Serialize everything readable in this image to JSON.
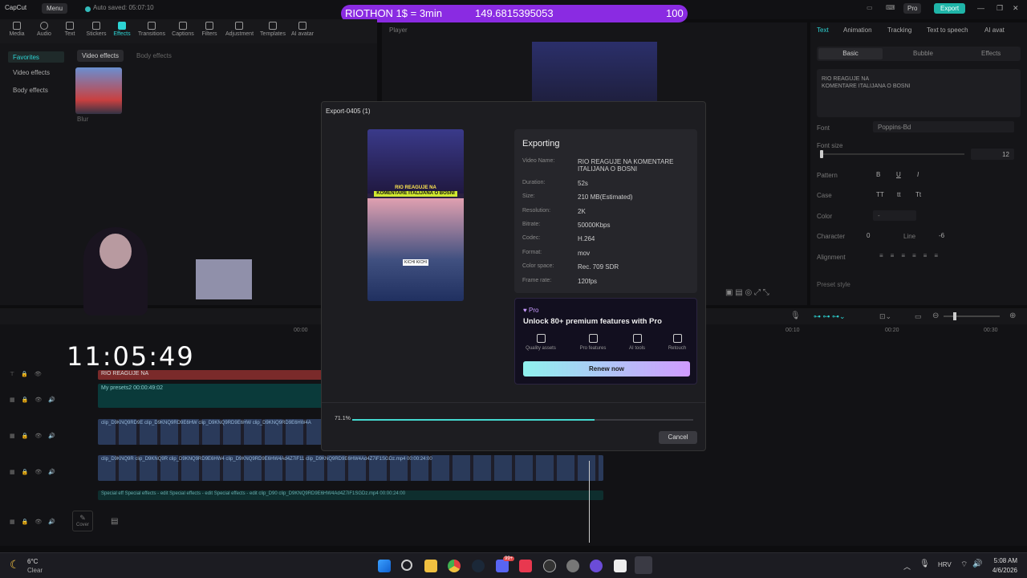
{
  "app": {
    "name": "CapCut",
    "menu_label": "Menu",
    "autosave": "Auto saved: 05:07:10",
    "pro_label": "Pro",
    "export_label": "Export"
  },
  "banner": {
    "left": "RIOTHON 1$ = 3min",
    "middle": "149.6815395053",
    "right": "100"
  },
  "toolbar": {
    "items": [
      "Media",
      "Audio",
      "Text",
      "Stickers",
      "Effects",
      "Transitions",
      "Captions",
      "Filters",
      "Adjustment",
      "Templates",
      "AI avatar"
    ],
    "active": "Effects"
  },
  "left_panel": {
    "sidebar": [
      "Favorites",
      "Video effects",
      "Body effects"
    ],
    "tabs": [
      "Video effects",
      "Body effects"
    ],
    "effect_name": "Blur"
  },
  "player": {
    "title": "Player"
  },
  "right_panel": {
    "tabs": [
      "Text",
      "Animation",
      "Tracking",
      "Text to speech",
      "AI avat"
    ],
    "subtabs": [
      "Basic",
      "Bubble",
      "Effects"
    ],
    "text_content_1": "RIO REAGUJE NA",
    "text_content_2": "KOMENTARE ITALIJANA O BOSNI",
    "font_label": "Font",
    "font_value": "Poppins-Bd",
    "font_size_label": "Font size",
    "font_size_value": "12",
    "pattern_label": "Pattern",
    "pattern_buttons": [
      "B",
      "U",
      "I"
    ],
    "case_label": "Case",
    "case_buttons": [
      "TT",
      "tt",
      "Tt"
    ],
    "color_label": "Color",
    "color_value": "-",
    "character_label": "Character",
    "character_value": "0",
    "line_label": "Line",
    "line_value": "-6",
    "alignment_label": "Alignment",
    "preset_label": "Preset style"
  },
  "timeline": {
    "times": [
      "00:00",
      "00:10",
      "00:20",
      "00:30"
    ],
    "text_track": "RIO REAGUJE NA",
    "preset_track": "My presets2  00:00:49:02",
    "clip_track_1": "clip_D9KNQ9RD9E  clip_D9KNQ9RD9E6HW  clip_D9KNQ9RD9E6HW  clip_D9KNQ9RD9E6HW4A",
    "clip_track_2": "clip_D9KNQ9R  clip_D9KNQ9R  clip_D9KNQ9RD9E6HW4  clip_D9KNQ9RD9E6HW4Ad4Z7iF11  clip_D9KNQ9RD9E6HW4Ad4Z7iF1SGDz.mp4  00:00:24:00",
    "effects_track": "Special eff  Special effects - edit  Special effects - edit  Special effects - edit  clip_D90  clip_D9KNQ9RD9E6HW4Ad4Z7iF1SGDz.mp4  00:00:24:00",
    "cover_label": "Cover"
  },
  "overlay": {
    "clock": "11:05:49"
  },
  "export_dialog": {
    "title": "Export-0405 (1)",
    "heading": "Exporting",
    "rows": [
      {
        "label": "Video Name:",
        "value": "RIO REAGUJE NA KOMENTARE ITALIJANA O BOSNI"
      },
      {
        "label": "Duration:",
        "value": "52s"
      },
      {
        "label": "Size:",
        "value": "210 MB(Estimated)"
      },
      {
        "label": "Resolution:",
        "value": "2K"
      },
      {
        "label": "Bitrate:",
        "value": "50000Kbps"
      },
      {
        "label": "Codec:",
        "value": "H.264"
      },
      {
        "label": "Format:",
        "value": "mov"
      },
      {
        "label": "Color space:",
        "value": "Rec. 709 SDR"
      },
      {
        "label": "Frame rate:",
        "value": "120fps"
      }
    ],
    "thumb_caption_1": "RIO REAGUJE NA",
    "thumb_caption_2": "KOMENTARE ITALIJANA O BOSNI",
    "thumb_caption_3": "KICHI KICHI",
    "pro_badge": "Pro",
    "pro_title": "Unlock 80+ premium features with Pro",
    "pro_features": [
      "Quality assets",
      "Pro features",
      "AI tools",
      "Retouch"
    ],
    "renew_label": "Renew now",
    "progress_text": "71.1%",
    "progress": 0.711,
    "cancel_label": "Cancel"
  },
  "taskbar": {
    "weather_temp": "6°C",
    "weather_desc": "Clear",
    "lang": "HRV",
    "time": "5:08 AM",
    "date": "4/6/2026",
    "badge": "99+"
  },
  "colors": {
    "accent": "#2dd4d4",
    "banner": "#8a2be2",
    "progress": "#44d9d0"
  }
}
